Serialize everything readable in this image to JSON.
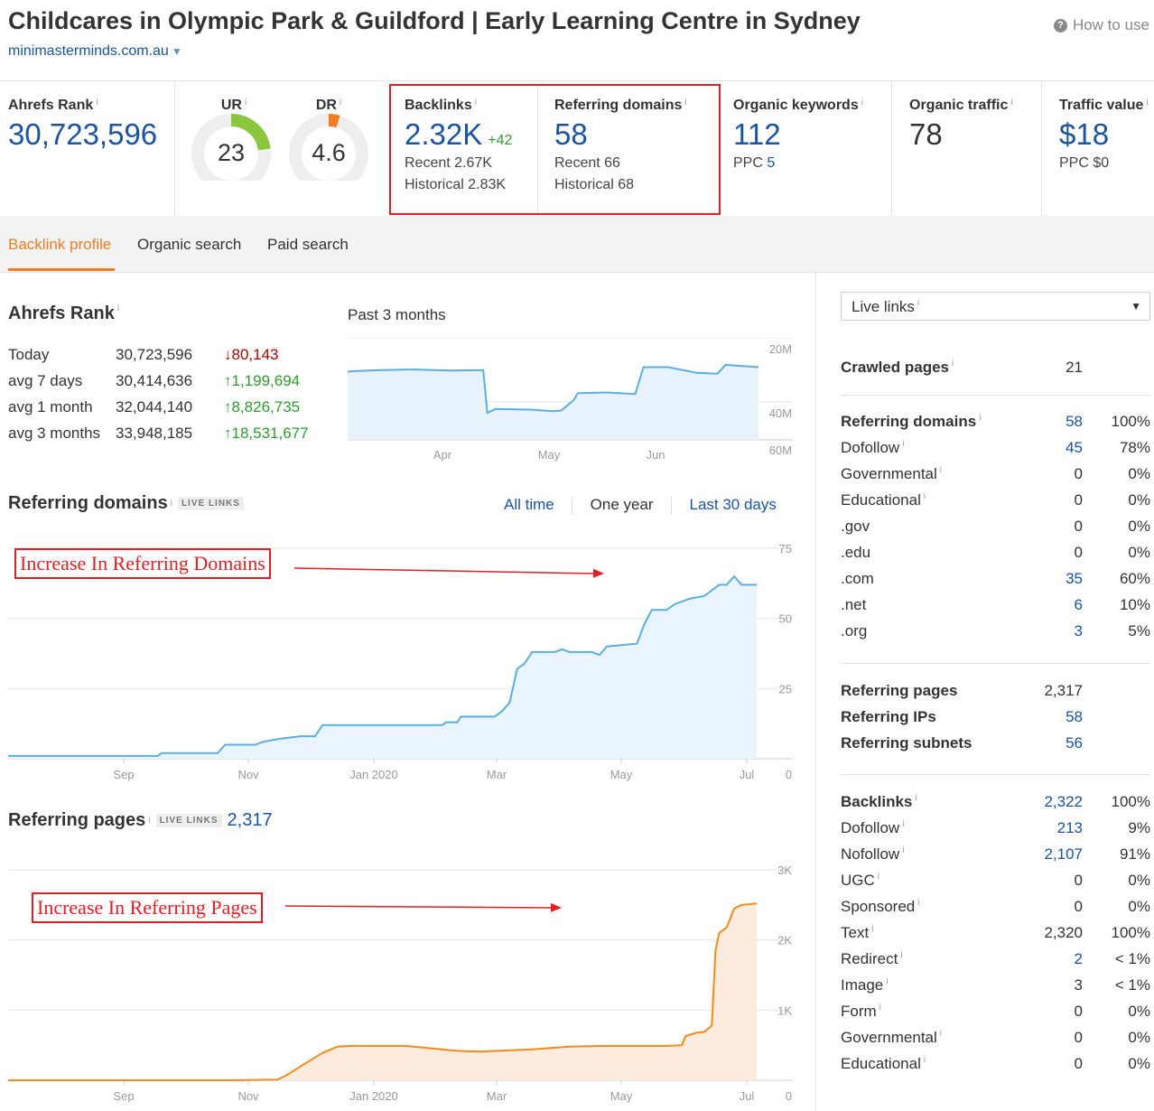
{
  "header": {
    "title": "Childcares in Olympic Park & Guildford | Early Learning Centre in Sydney",
    "url": "minimasterminds.com.au",
    "how_to_use": "How to use"
  },
  "metrics": {
    "ahrefs_rank": {
      "label": "Ahrefs Rank",
      "value": "30,723,596"
    },
    "ur": {
      "label": "UR",
      "value": "23",
      "level": 23
    },
    "dr": {
      "label": "DR",
      "value": "4.6",
      "level": 4.6
    },
    "backlinks": {
      "label": "Backlinks",
      "value": "2.32K",
      "delta": "+42",
      "recent": "Recent 2.67K",
      "historical": "Historical 2.83K"
    },
    "referring_domains": {
      "label": "Referring domains",
      "value": "58",
      "recent": "Recent 66",
      "historical": "Historical 68"
    },
    "organic_keywords": {
      "label": "Organic keywords",
      "value": "112",
      "ppc_label": "PPC",
      "ppc_value": "5"
    },
    "organic_traffic": {
      "label": "Organic traffic",
      "value": "78"
    },
    "traffic_value": {
      "label": "Traffic value",
      "value": "$18",
      "ppc": "PPC $0"
    }
  },
  "tabs": [
    "Backlink profile",
    "Organic search",
    "Paid search"
  ],
  "ahrefs_rank_section": {
    "title": "Ahrefs Rank",
    "rows": [
      {
        "label": "Today",
        "value": "30,723,596",
        "change": "80,143",
        "dir": "down"
      },
      {
        "label": "avg 7 days",
        "value": "30,414,636",
        "change": "1,199,694",
        "dir": "up"
      },
      {
        "label": "avg 1 month",
        "value": "32,044,140",
        "change": "8,826,735",
        "dir": "up"
      },
      {
        "label": "avg 3 months",
        "value": "33,948,185",
        "change": "18,531,677",
        "dir": "up"
      }
    ],
    "chart_title": "Past 3 months"
  },
  "referring_domains_section": {
    "title": "Referring domains",
    "live": "LIVE LINKS",
    "periods": [
      "All time",
      "One year",
      "Last 30 days"
    ],
    "annotation": "Increase In Referring Domains"
  },
  "referring_pages_section": {
    "title": "Referring pages",
    "live": "LIVE LINKS",
    "value": "2,317",
    "annotation": "Increase In Referring Pages"
  },
  "sidebar": {
    "select": "Live links",
    "crawled": {
      "label": "Crawled pages",
      "value": "21"
    },
    "ref_domains": [
      {
        "label": "Referring domains",
        "v": "58",
        "p": "100%",
        "bold": true,
        "link": true,
        "info": true
      },
      {
        "label": "Dofollow",
        "v": "45",
        "p": "78%",
        "link": true,
        "info": true
      },
      {
        "label": "Governmental",
        "v": "0",
        "p": "0%",
        "info": true
      },
      {
        "label": "Educational",
        "v": "0",
        "p": "0%",
        "info": true
      },
      {
        "label": ".gov",
        "v": "0",
        "p": "0%"
      },
      {
        "label": ".edu",
        "v": "0",
        "p": "0%"
      },
      {
        "label": ".com",
        "v": "35",
        "p": "60%",
        "link": true
      },
      {
        "label": ".net",
        "v": "6",
        "p": "10%",
        "link": true
      },
      {
        "label": ".org",
        "v": "3",
        "p": "5%",
        "link": true
      }
    ],
    "ref_other": [
      {
        "label": "Referring pages",
        "v": "2,317",
        "p": "",
        "bold": true
      },
      {
        "label": "Referring IPs",
        "v": "58",
        "p": "",
        "bold": true,
        "link": true
      },
      {
        "label": "Referring subnets",
        "v": "56",
        "p": "",
        "bold": true,
        "link": true
      }
    ],
    "backlinks": [
      {
        "label": "Backlinks",
        "v": "2,322",
        "p": "100%",
        "bold": true,
        "link": true,
        "info": true
      },
      {
        "label": "Dofollow",
        "v": "213",
        "p": "9%",
        "link": true,
        "info": true
      },
      {
        "label": "Nofollow",
        "v": "2,107",
        "p": "91%",
        "link": true,
        "info": true
      },
      {
        "label": "UGC",
        "v": "0",
        "p": "0%",
        "info": true
      },
      {
        "label": "Sponsored",
        "v": "0",
        "p": "0%",
        "info": true
      },
      {
        "label": "Text",
        "v": "2,320",
        "p": "100%",
        "info": true
      },
      {
        "label": "Redirect",
        "v": "2",
        "p": "< 1%",
        "link": true,
        "info": true
      },
      {
        "label": "Image",
        "v": "3",
        "p": "< 1%",
        "info": true
      },
      {
        "label": "Form",
        "v": "0",
        "p": "0%",
        "info": true
      },
      {
        "label": "Governmental",
        "v": "0",
        "p": "0%",
        "info": true
      },
      {
        "label": "Educational",
        "v": "0",
        "p": "0%",
        "info": true
      }
    ]
  },
  "chart_data": [
    {
      "type": "line",
      "title": "Past 3 months",
      "x_ticks": [
        "Apr",
        "May",
        "Jun"
      ],
      "y_ticks": [
        "20M",
        "40M",
        "60M"
      ],
      "ylim": [
        20000000,
        60000000
      ],
      "y_inverted": true,
      "series": [
        {
          "values": [
            [
              0,
              29900000
            ],
            [
              2,
              29700000
            ],
            [
              8,
              29500000
            ],
            [
              16,
              29300000
            ],
            [
              25,
              29600000
            ],
            [
              33,
              29500000
            ],
            [
              34,
              40600000
            ],
            [
              36,
              39600000
            ],
            [
              45,
              39800000
            ],
            [
              50,
              40200000
            ],
            [
              52,
              40000000
            ],
            [
              55,
              37300000
            ],
            [
              56,
              35500000
            ],
            [
              63,
              35300000
            ],
            [
              70,
              35700000
            ],
            [
              72,
              28700000
            ],
            [
              78,
              28700000
            ],
            [
              85,
              30200000
            ],
            [
              90,
              30400000
            ],
            [
              92,
              28100000
            ],
            [
              100,
              28700000
            ]
          ]
        }
      ]
    },
    {
      "type": "area",
      "title": "Referring domains",
      "x_ticks": [
        "Sep",
        "Nov",
        "Jan 2020",
        "Mar",
        "May",
        "Jul"
      ],
      "y_ticks": [
        "75",
        "50",
        "25",
        "0"
      ],
      "ylim": [
        0,
        75
      ],
      "color": "#5aaee0",
      "series": [
        {
          "values": [
            [
              0,
              1
            ],
            [
              20,
              1
            ],
            [
              20.5,
              2
            ],
            [
              28,
              2
            ],
            [
              29,
              5
            ],
            [
              33,
              5
            ],
            [
              34,
              6
            ],
            [
              36,
              7
            ],
            [
              39,
              8
            ],
            [
              41,
              8
            ],
            [
              42,
              12
            ],
            [
              46,
              12
            ],
            [
              58,
              12
            ],
            [
              58.5,
              13
            ],
            [
              60,
              13
            ],
            [
              60.5,
              15
            ],
            [
              62,
              15
            ],
            [
              65,
              15
            ],
            [
              66,
              17
            ],
            [
              67,
              20
            ],
            [
              68,
              32
            ],
            [
              69,
              34
            ],
            [
              70,
              38
            ],
            [
              73,
              38
            ],
            [
              74,
              39
            ],
            [
              75,
              38
            ],
            [
              78,
              38
            ],
            [
              79,
              37
            ],
            [
              80,
              40
            ],
            [
              84,
              41
            ],
            [
              85,
              48
            ],
            [
              86,
              53
            ],
            [
              88,
              53
            ],
            [
              89,
              55
            ],
            [
              91,
              57
            ],
            [
              93,
              58
            ],
            [
              94,
              60
            ],
            [
              95,
              62
            ],
            [
              96,
              62
            ],
            [
              97,
              65
            ],
            [
              98,
              62
            ],
            [
              100,
              62
            ]
          ]
        }
      ]
    },
    {
      "type": "area",
      "title": "Referring pages",
      "x_ticks": [
        "Sep",
        "Nov",
        "Jan 2020",
        "Mar",
        "May",
        "Jul"
      ],
      "y_ticks": [
        "3K",
        "2K",
        "1K",
        "0"
      ],
      "ylim": [
        0,
        3000
      ],
      "color": "#f28a1e",
      "series": [
        {
          "values": [
            [
              0,
              0
            ],
            [
              30,
              0
            ],
            [
              36,
              10
            ],
            [
              37,
              60
            ],
            [
              40,
              260
            ],
            [
              42,
              390
            ],
            [
              44,
              480
            ],
            [
              46,
              490
            ],
            [
              53,
              490
            ],
            [
              56,
              460
            ],
            [
              60,
              420
            ],
            [
              63,
              410
            ],
            [
              70,
              440
            ],
            [
              75,
              480
            ],
            [
              80,
              490
            ],
            [
              88,
              490
            ],
            [
              90,
              500
            ],
            [
              90.5,
              630
            ],
            [
              92,
              680
            ],
            [
              93,
              690
            ],
            [
              94,
              780
            ],
            [
              94.5,
              1850
            ],
            [
              95,
              2100
            ],
            [
              96,
              2180
            ],
            [
              97,
              2450
            ],
            [
              98,
              2500
            ],
            [
              100,
              2520
            ]
          ]
        }
      ]
    }
  ]
}
